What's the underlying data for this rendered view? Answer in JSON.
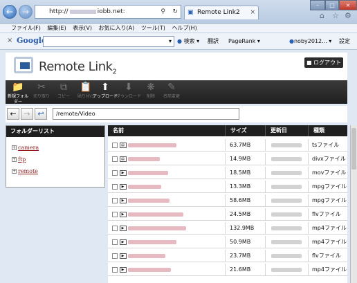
{
  "browser": {
    "address_prefix": "http://",
    "address_suffix": "iobb.net:",
    "tab_title": "Remote Link2",
    "menu": [
      "ファイル(F)",
      "編集(E)",
      "表示(V)",
      "お気に入り(A)",
      "ツール(T)",
      "ヘルプ(H)"
    ],
    "google": {
      "logo": "Google",
      "search_button": "検索",
      "translate": "翻訳",
      "pagerank": "PageRank",
      "user": "noby2012...",
      "settings": "設定"
    }
  },
  "app": {
    "logo_text": "Remote Link",
    "logo_version": "2",
    "logout_label": "ログアウト",
    "toolbar": [
      {
        "label": "新規フォルダー",
        "enabled": true,
        "icon": "new-folder-icon"
      },
      {
        "label": "切り取り",
        "enabled": false,
        "icon": "cut-icon"
      },
      {
        "label": "コピー",
        "enabled": false,
        "icon": "copy-icon"
      },
      {
        "label": "貼り付け",
        "enabled": false,
        "icon": "paste-icon"
      },
      {
        "label": "アップロード",
        "enabled": true,
        "icon": "upload-icon"
      },
      {
        "label": "ダウンロード",
        "enabled": false,
        "icon": "download-icon"
      },
      {
        "label": "削除",
        "enabled": false,
        "icon": "delete-icon"
      },
      {
        "label": "名前変更",
        "enabled": false,
        "icon": "rename-icon"
      }
    ],
    "path": "/remote/Video",
    "folder_list": {
      "title": "フォルダーリスト",
      "items": [
        "camera",
        "ftp",
        "remote"
      ]
    },
    "table": {
      "columns": [
        "名前",
        "サイズ",
        "更新日",
        "種類"
      ],
      "rows": [
        {
          "size": "63.7MB",
          "type": "tsファイル"
        },
        {
          "size": "14.9MB",
          "type": "divxファイル"
        },
        {
          "size": "18.5MB",
          "type": "movファイル"
        },
        {
          "size": "13.3MB",
          "type": "mpgファイル"
        },
        {
          "size": "58.6MB",
          "type": "mpgファイル"
        },
        {
          "size": "24.5MB",
          "type": "flvファイル"
        },
        {
          "size": "132.9MB",
          "type": "mp4ファイル"
        },
        {
          "size": "50.9MB",
          "type": "mp4ファイル"
        },
        {
          "size": "23.7MB",
          "type": "flvファイル"
        },
        {
          "size": "21.6MB",
          "type": "mp4ファイル"
        }
      ]
    }
  }
}
